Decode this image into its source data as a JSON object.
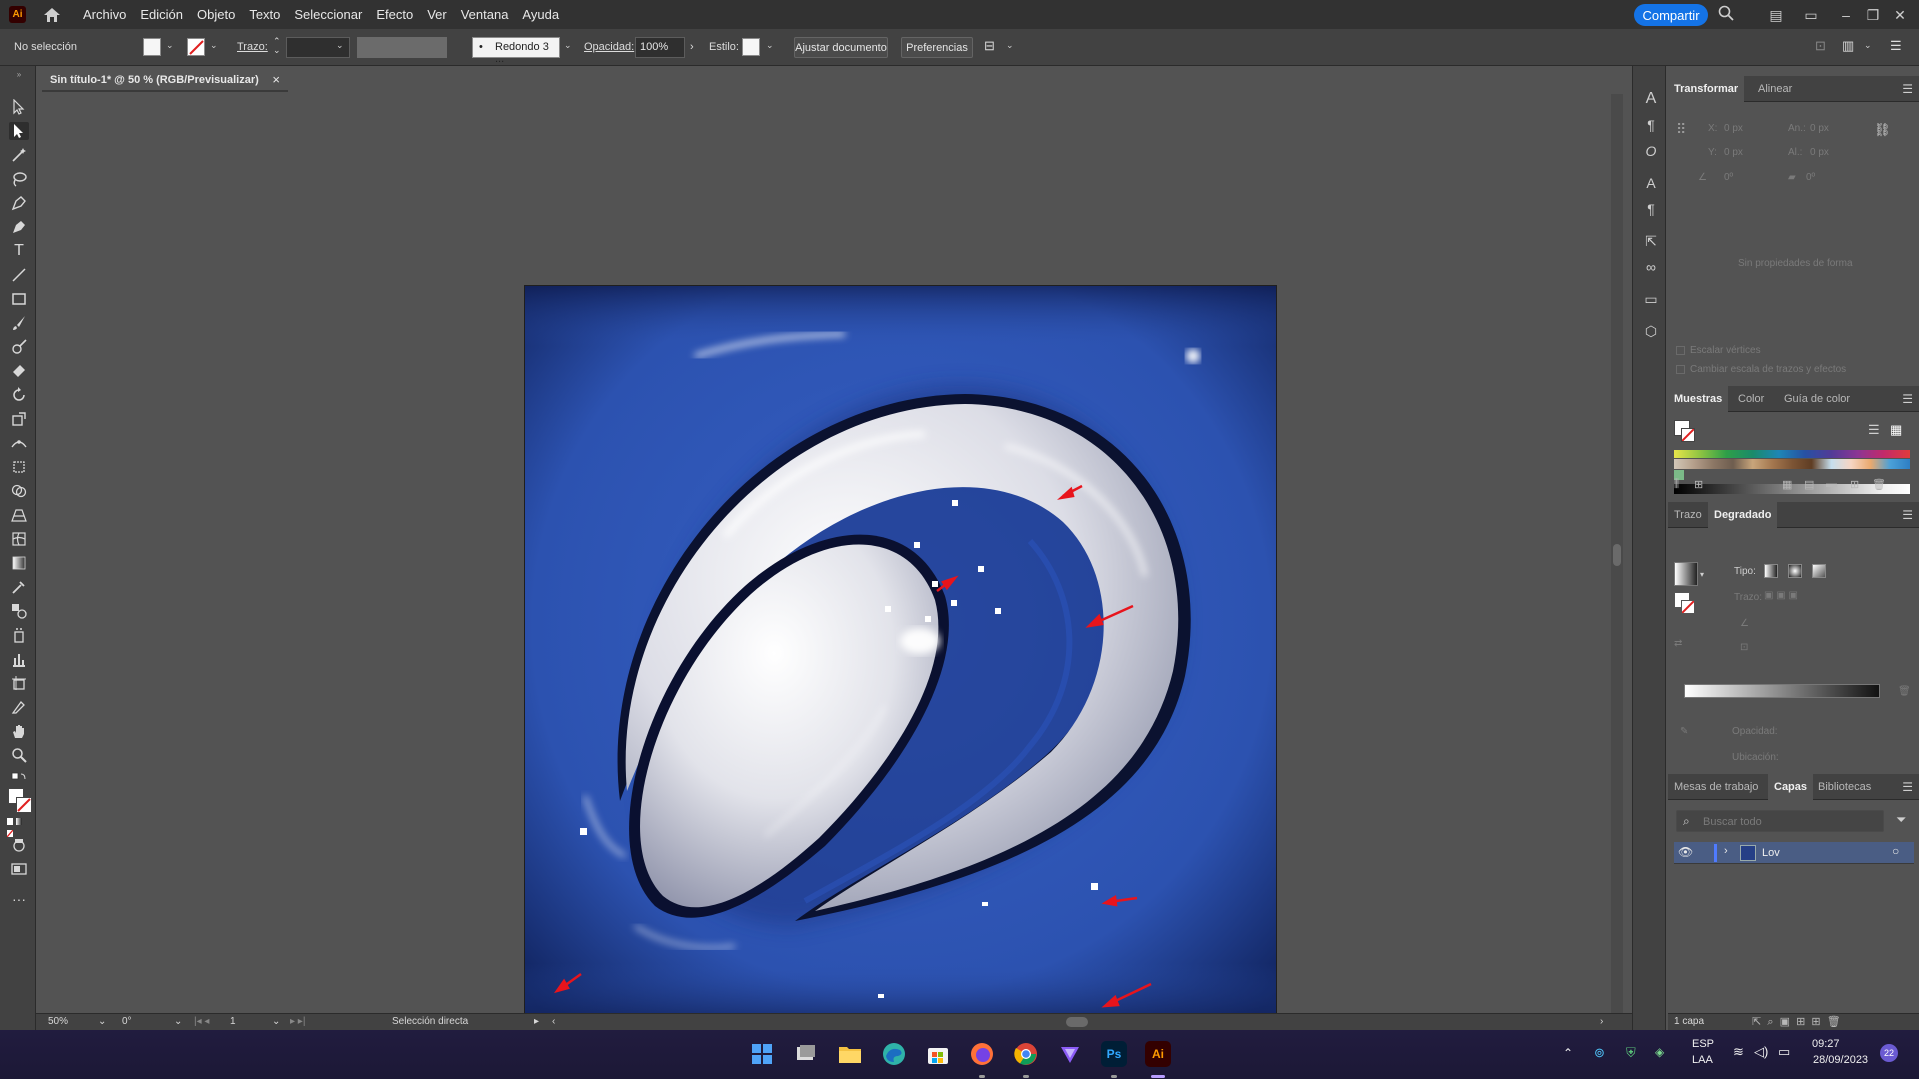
{
  "app": {
    "logo": "Ai",
    "menu": [
      "Archivo",
      "Edición",
      "Objeto",
      "Texto",
      "Seleccionar",
      "Efecto",
      "Ver",
      "Ventana",
      "Ayuda"
    ],
    "share_label": "Compartir"
  },
  "control_bar": {
    "selection_label": "No selección",
    "stroke_label": "Trazo:",
    "brush_label": "Redondo 3 ...",
    "opacity_label": "Opacidad:",
    "opacity_value": "100%",
    "style_label": "Estilo:",
    "fit_document_label": "Ajustar documento",
    "preferences_label": "Preferencias"
  },
  "document": {
    "tab_title": "Sin título-1* @ 50 % (RGB/Previsualizar)"
  },
  "transform_panel": {
    "tabs": [
      "Transformar",
      "Alinear"
    ],
    "x_label": "X:",
    "x_value": "0 px",
    "y_label": "Y:",
    "y_value": "0 px",
    "w_label": "An.:",
    "w_value": "0 px",
    "h_label": "Al.:",
    "h_value": "0 px",
    "angle_value": "0º",
    "shear_value": "0º",
    "no_shape_text": "Sin propiedades de forma",
    "scale_corners": "Escalar vértices",
    "scale_strokes": "Cambiar escala de trazos y efectos"
  },
  "swatches_panel": {
    "tabs": [
      "Muestras",
      "Color",
      "Guía de color"
    ]
  },
  "gradient_panel": {
    "tabs": [
      "Trazo",
      "Degradado"
    ],
    "type_label": "Tipo:",
    "stroke_label": "Trazo:",
    "opacity_label": "Opacidad:",
    "location_label": "Ubicación:"
  },
  "layers_panel": {
    "tabs": [
      "Mesas de trabajo",
      "Capas",
      "Bibliotecas"
    ],
    "search_placeholder": "Buscar todo",
    "layer_name": "Lov",
    "layer_count": "1 capa"
  },
  "status_bar": {
    "zoom": "50%",
    "rotation": "0°",
    "artboard_number": "1",
    "tool_name": "Selección directa"
  },
  "taskbar": {
    "language": "ESP",
    "language_sub": "LAA",
    "time": "09:27",
    "date": "28/09/2023",
    "notification_count": "22",
    "apps": [
      "windows-start",
      "task-view",
      "file-explorer",
      "edge",
      "store",
      "firefox",
      "chrome",
      "proton-vpn",
      "photoshop",
      "illustrator"
    ]
  },
  "colors": {
    "accent": "#1473e6",
    "artboard_blue": "#2a4ea8"
  }
}
